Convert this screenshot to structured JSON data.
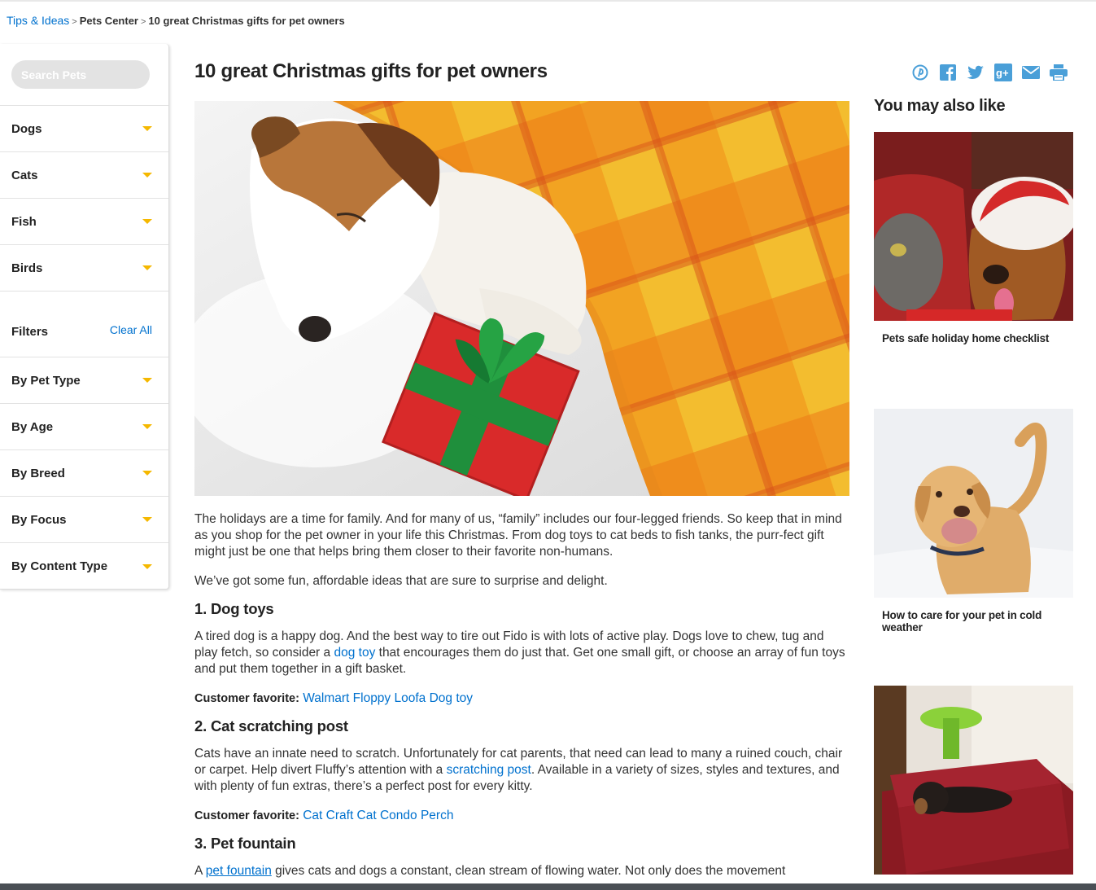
{
  "breadcrumb": {
    "items": [
      "Tips & Ideas",
      "Pets Center",
      "10 great Christmas gifts for pet owners"
    ],
    "separator": ">"
  },
  "sidebar": {
    "search_placeholder": "Search Pets",
    "categories": [
      {
        "label": "Dogs"
      },
      {
        "label": "Cats"
      },
      {
        "label": "Fish"
      },
      {
        "label": "Birds"
      }
    ],
    "filters_label": "Filters",
    "clear_all": "Clear All",
    "filters": [
      {
        "label": "By Pet Type"
      },
      {
        "label": "By Age"
      },
      {
        "label": "By Breed"
      },
      {
        "label": "By Focus"
      },
      {
        "label": "By Content Type"
      }
    ]
  },
  "article": {
    "title": "10 great Christmas gifts for pet owners",
    "hero_icon": "sleeping-dog-with-gift-image",
    "intro_1": "The holidays are a time for family. And for many of us, “family” includes our four-legged friends. So keep that in mind as you shop for the pet owner in your life this Christmas. From dog toys to cat beds to fish tanks, the purr-fect gift might just be one that helps bring them closer to their favorite non-humans.",
    "intro_2": "We’ve got some fun, affordable ideas that are sure to surprise and delight.",
    "sections": [
      {
        "heading": "1. Dog toys",
        "text_before": "A tired dog is a happy dog. And the best way to tire out Fido is with lots of active play. Dogs love to chew, tug and play fetch, so consider a ",
        "link": "dog toy",
        "text_after": " that encourages them do just that. Get one small gift, or choose an array of fun toys and put them together in a gift basket.",
        "favorite_label": "Customer favorite:",
        "favorite_link": "Walmart Floppy Loofa Dog toy"
      },
      {
        "heading": "2. Cat scratching post",
        "text_before": "Cats have an innate need to scratch. Unfortunately for cat parents, that need can lead to many a ruined couch, chair or carpet. Help divert Fluffy’s attention with a ",
        "link": "scratching post",
        "text_after": ". Available in a variety of sizes, styles and textures, and with plenty of fun extras, there’s a perfect post for every kitty.",
        "favorite_label": "Customer favorite:",
        "favorite_link": "Cat Craft Cat Condo Perch"
      },
      {
        "heading": "3. Pet fountain",
        "text_before": "A ",
        "link": "pet fountain",
        "text_after": " gives cats and dogs a constant, clean stream of flowing water. Not only does the movement"
      }
    ]
  },
  "share": {
    "icons": [
      "pinterest-icon",
      "facebook-icon",
      "twitter-icon",
      "google-plus-icon",
      "email-icon",
      "print-icon"
    ],
    "color": "#4a9fd8"
  },
  "rail": {
    "title": "You may also like",
    "cards": [
      {
        "title": "Pets safe holiday home checklist",
        "image": "cat-and-dog-in-santa-hat-image"
      },
      {
        "title": "How to care for your pet in cold weather",
        "image": "labrador-in-snow-image"
      },
      {
        "title": "",
        "image": "dachshund-in-pet-bed-image"
      }
    ]
  },
  "colors": {
    "link": "#0071ce",
    "caret": "#f5b800",
    "search_bg": "#e3e3e3"
  }
}
